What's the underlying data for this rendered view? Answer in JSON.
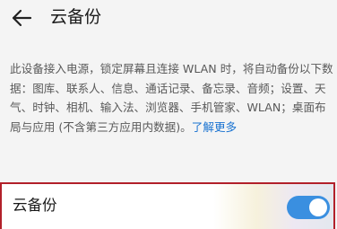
{
  "header": {
    "back_icon": "arrow-left-icon",
    "title": "云备份"
  },
  "description": {
    "text": "此设备接入电源，锁定屏幕且连接 WLAN 时，将自动备份以下数据：图库、联系人、信息、通话记录、备忘录、音频；设置、天气、时钟、相机、输入法、浏览器、手机管家、WLAN；桌面布局与应用 (不含第三方应用内数据)。",
    "link_text": "了解更多"
  },
  "setting": {
    "label": "云备份",
    "toggle_state": "on"
  },
  "colors": {
    "accent": "#3a8fe0",
    "link": "#1a73d1",
    "highlight_border": "#b2202a"
  }
}
